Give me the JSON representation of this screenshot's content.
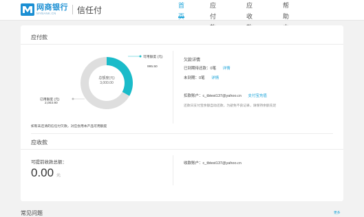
{
  "brand": {
    "name_cn": "网商银行",
    "name_en": "MYBANK.CN",
    "product": "信任付",
    "accent": "#1aa3d9"
  },
  "nav": [
    {
      "label": "首页",
      "active": true
    },
    {
      "label": "应付款",
      "active": false
    },
    {
      "label": "应收款",
      "active": false
    },
    {
      "label": "帮助中心",
      "active": false
    }
  ],
  "payable": {
    "title": "应付款",
    "chart_data": {
      "type": "pie",
      "title": "",
      "center_label": "总额度(元)",
      "center_value": "3,000.00",
      "slices": [
        {
          "name": "可用额度 (元)",
          "value": 995.5,
          "display": "995.50",
          "color": "#1abbc9"
        },
        {
          "name": "已用额度 (元)",
          "value": 2003.9,
          "display": "2,003.90",
          "color": "#dedede"
        }
      ]
    },
    "detail": {
      "title": "欠款详情",
      "overdue_label": "已到期待还款：",
      "overdue_count": "0笔",
      "overdue_link": "详情",
      "pending_label": "未到期：",
      "pending_count": "0笔",
      "pending_link": "详情",
      "account_label": "扣款账户：",
      "account_value": "c_tbtest137@yahoo.cn",
      "account_link": "支付宝充值",
      "note": "还款日支付宝余额自动还款，为避免不良记录，请保持余额充足"
    },
    "footnote": "如有未还清的信任付欠款，对应会用本产品可用额度"
  },
  "receivable": {
    "title": "应收款",
    "amount_label": "可提前收款总额：",
    "amount": "0.00",
    "unit": "元",
    "account_label": "收款账户：",
    "account_value": "c_tbtest137@yahoo.cn"
  },
  "faq": {
    "title": "常见问题",
    "more": "更多"
  }
}
